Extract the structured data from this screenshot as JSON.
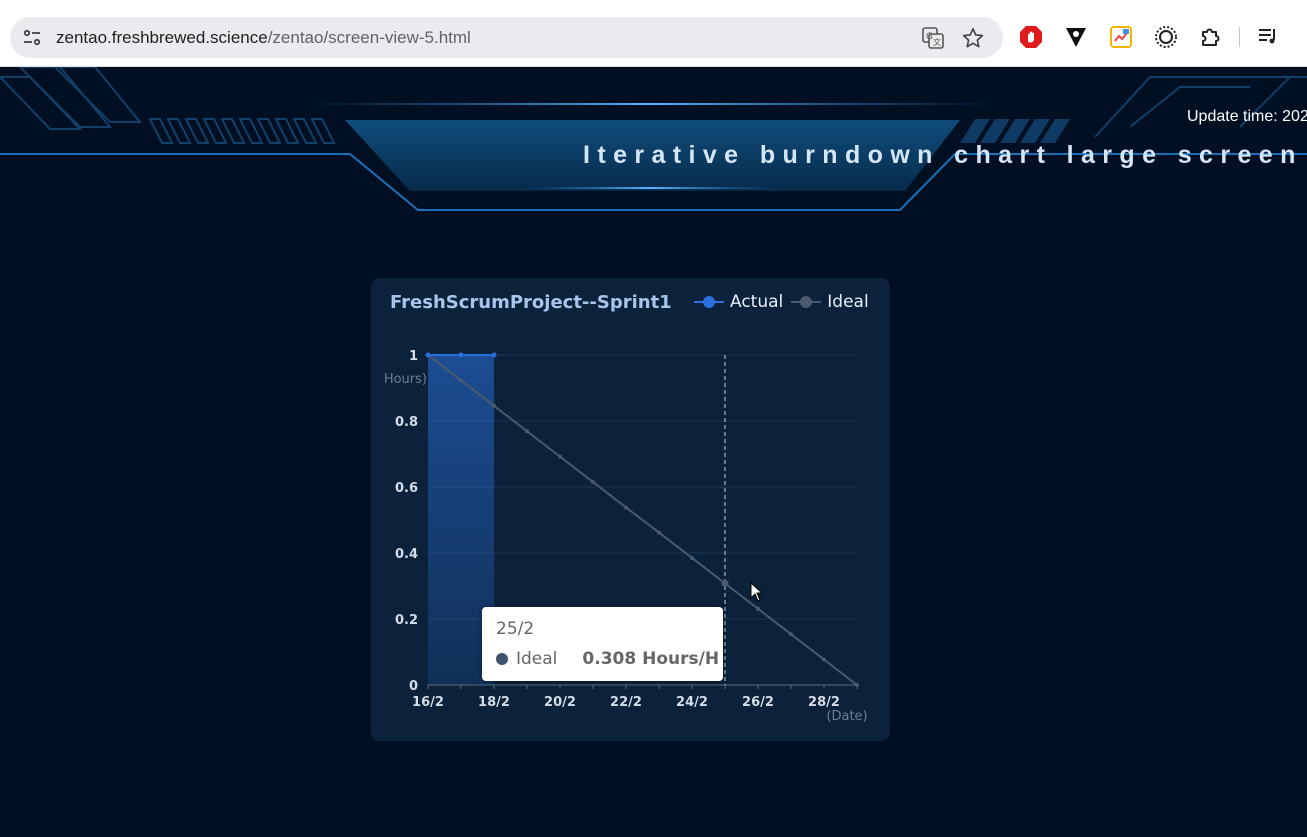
{
  "browser": {
    "url_host": "zentao.freshbrewed.science",
    "url_path": "/zentao/screen-view-5.html",
    "icons": [
      "site-info-icon",
      "translate-icon",
      "bookmark-star-icon",
      "ublock-icon",
      "vivaldi-ext-icon",
      "colorful-ext-icon",
      "sunburst-ext-icon",
      "extensions-puzzle-icon",
      "media-queue-icon"
    ]
  },
  "dashboard": {
    "update_time": "Update time: 202",
    "title": "Iterative burndown chart large screen"
  },
  "card": {
    "title": "FreshScrumProject--Sprint1",
    "legend": [
      {
        "name": "Actual",
        "color": "#2a6fdb"
      },
      {
        "name": "Ideal",
        "color": "#4b5a6d"
      }
    ]
  },
  "chart_data": {
    "type": "line",
    "title": "FreshScrumProject--Sprint1",
    "xlabel": "(Date)",
    "ylabel": "Hours)",
    "x": [
      "16/2",
      "17/2",
      "18/2",
      "19/2",
      "20/2",
      "21/2",
      "22/2",
      "23/2",
      "24/2",
      "25/2",
      "26/2",
      "27/2",
      "28/2",
      "29/2"
    ],
    "x_tick_labels": [
      "16/2",
      "18/2",
      "20/2",
      "22/2",
      "24/2",
      "26/2",
      "28/2"
    ],
    "y_ticks": [
      "0",
      "0.2",
      "0.4",
      "0.6",
      "0.8",
      "1"
    ],
    "ylim": [
      0,
      1
    ],
    "grid": true,
    "legend_position": "top-right",
    "series": [
      {
        "name": "Actual",
        "color": "#2a6fdb",
        "area": true,
        "values": [
          1,
          1,
          1
        ]
      },
      {
        "name": "Ideal",
        "color": "#4b5a6d",
        "values": [
          1,
          0.923,
          0.846,
          0.769,
          0.692,
          0.615,
          0.538,
          0.462,
          0.385,
          0.308,
          0.231,
          0.154,
          0.077,
          0
        ]
      }
    ],
    "hover_index": 9
  },
  "tooltip": {
    "date": "25/2",
    "series": "Ideal",
    "value": "0.308 Hours/H"
  }
}
